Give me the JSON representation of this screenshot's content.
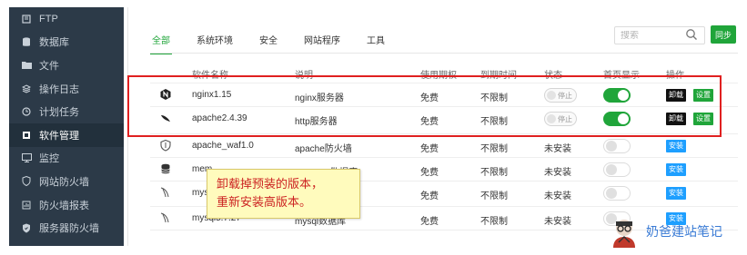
{
  "sidebar": {
    "items": [
      {
        "label": "FTP",
        "icon": "ftp-icon"
      },
      {
        "label": "数据库",
        "icon": "database-icon"
      },
      {
        "label": "文件",
        "icon": "folder-icon"
      },
      {
        "label": "操作日志",
        "icon": "log-icon"
      },
      {
        "label": "计划任务",
        "icon": "clock-icon"
      },
      {
        "label": "软件管理",
        "icon": "software-icon",
        "active": true
      },
      {
        "label": "监控",
        "icon": "monitor-icon"
      },
      {
        "label": "网站防火墙",
        "icon": "shield-icon"
      },
      {
        "label": "防火墙报表",
        "icon": "report-icon"
      },
      {
        "label": "服务器防火墙",
        "icon": "server-shield-icon"
      }
    ]
  },
  "tabs": [
    {
      "label": "全部",
      "active": true
    },
    {
      "label": "系统环境"
    },
    {
      "label": "安全"
    },
    {
      "label": "网站程序"
    },
    {
      "label": "工具"
    }
  ],
  "search": {
    "placeholder": "搜索"
  },
  "sync_label": "同步",
  "table": {
    "headers": {
      "name": "软件名称",
      "desc": "说明",
      "price": "使用期权",
      "expire": "到期时间",
      "status": "状态",
      "home": "首页显示",
      "ops": "操作"
    },
    "rows": [
      {
        "name": "nginx1.15",
        "desc": "nginx服务器",
        "price": "免费",
        "expire": "不限制",
        "status": "停止",
        "installed": true,
        "home_on": true,
        "uninstall": "卸载",
        "settings": "设置"
      },
      {
        "name": "apache2.4.39",
        "desc": "http服务器",
        "price": "免费",
        "expire": "不限制",
        "status": "停止",
        "installed": true,
        "home_on": true,
        "uninstall": "卸载",
        "settings": "设置"
      },
      {
        "name": "apache_waf1.0",
        "desc": "apache防火墙",
        "price": "免费",
        "expire": "不限制",
        "status": "未安装",
        "installed": false,
        "install": "安装"
      },
      {
        "name": "mem",
        "desc": "数据库",
        "price": "免费",
        "expire": "不限制",
        "status": "未安装",
        "installed": false,
        "install": "安装"
      },
      {
        "name": "mys",
        "desc": "",
        "price": "免费",
        "expire": "不限制",
        "status": "未安装",
        "installed": false,
        "install": "安装"
      },
      {
        "name": "mysql5.7.27",
        "desc": "mysql数据库",
        "price": "免费",
        "expire": "不限制",
        "status": "未安装",
        "installed": false,
        "install": "安装"
      }
    ]
  },
  "note": {
    "line1": "卸载掉预装的版本，",
    "line2": "重新安装高版本。"
  },
  "watermark": "奶爸建站笔记",
  "colors": {
    "accent": "#20a53a",
    "highlight": "#e02020",
    "install": "#1e9fff",
    "sidebar": "#2c3a48"
  }
}
